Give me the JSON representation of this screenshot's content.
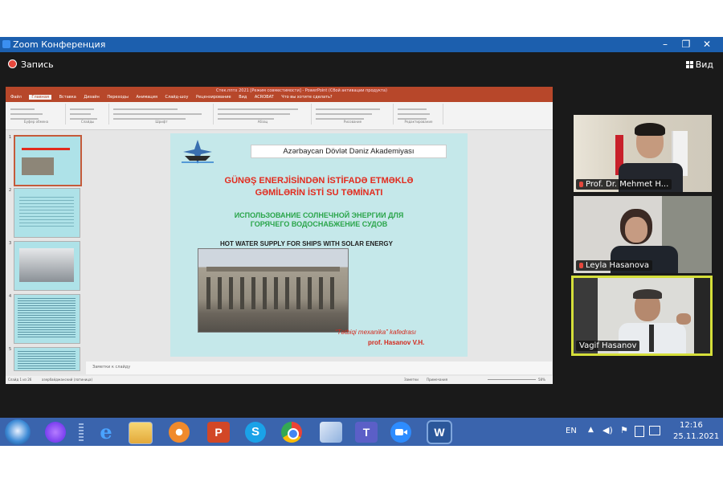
{
  "window": {
    "title": "Zoom Конференция",
    "record_label": "Запись",
    "view_label": "Вид",
    "controls": [
      "–",
      "❐",
      "✕"
    ]
  },
  "presentation": {
    "title_bar": "Стек.пптх 2021 [Режим совместимости] - PowerPoint (Сбой активации продукта)",
    "tabs": [
      "Файл",
      "Главная",
      "Вставка",
      "Дизайн",
      "Переходы",
      "Анимация",
      "Слайд-шоу",
      "Рецензирование",
      "Вид",
      "ACROBAT",
      "Что вы хотите сделать?"
    ],
    "ribbon_groups": [
      "Буфер обмена",
      "Слайды",
      "Шрифт",
      "Абзац",
      "Рисование",
      "Редактирование"
    ],
    "thumbnail_numbers": [
      "1",
      "2",
      "3",
      "4",
      "5"
    ],
    "notes_placeholder": "Заметки к слайду",
    "status_left": "Слайд 1 из 26",
    "status_lang": "азербайджанский (латиница)",
    "status_notes": "Заметки",
    "status_comments": "Примечания",
    "zoom": "58%",
    "slide": {
      "header": "Azərbaycan Dövlət Dəniz Akademiyası",
      "title_az_line1": "GÜNƏŞ ENERJİSİNDƏN İSTİFADƏ ETMƏKLƏ",
      "title_az_line2": "GƏMİLƏRİN İSTİ SU TƏMİNATI",
      "title_ru_line1": "ИСПОЛЬЗОВАНИЕ СОЛНЕЧНОЙ ЭНЕРГИИ ДЛЯ",
      "title_ru_line2": "ГОРЯЧЕГО ВОДОСНАБЖЕНИЕ СУДОВ",
      "title_en": "HOT WATER SUPPLY FOR SHIPS WITH SOLAR ENERGY",
      "department": "“Tətbiqi mexanika” kafedrası",
      "author": "prof. Hasanov V.H."
    }
  },
  "participants": [
    {
      "name": "Prof. Dr. Mehmet H...",
      "muted": true
    },
    {
      "name": "Leyla Hasanova",
      "muted": true
    },
    {
      "name": "Vagif Hasanov",
      "muted": false,
      "active": true
    }
  ],
  "taskbar": {
    "language": "EN",
    "time": "12:16",
    "date": "25.11.2021",
    "apps": [
      "Alice",
      "Internet Explorer",
      "File Explorer",
      "Media Player",
      "PowerPoint",
      "Skype",
      "Chrome",
      "Snipping Tool",
      "Teams",
      "Zoom",
      "Word"
    ]
  }
}
